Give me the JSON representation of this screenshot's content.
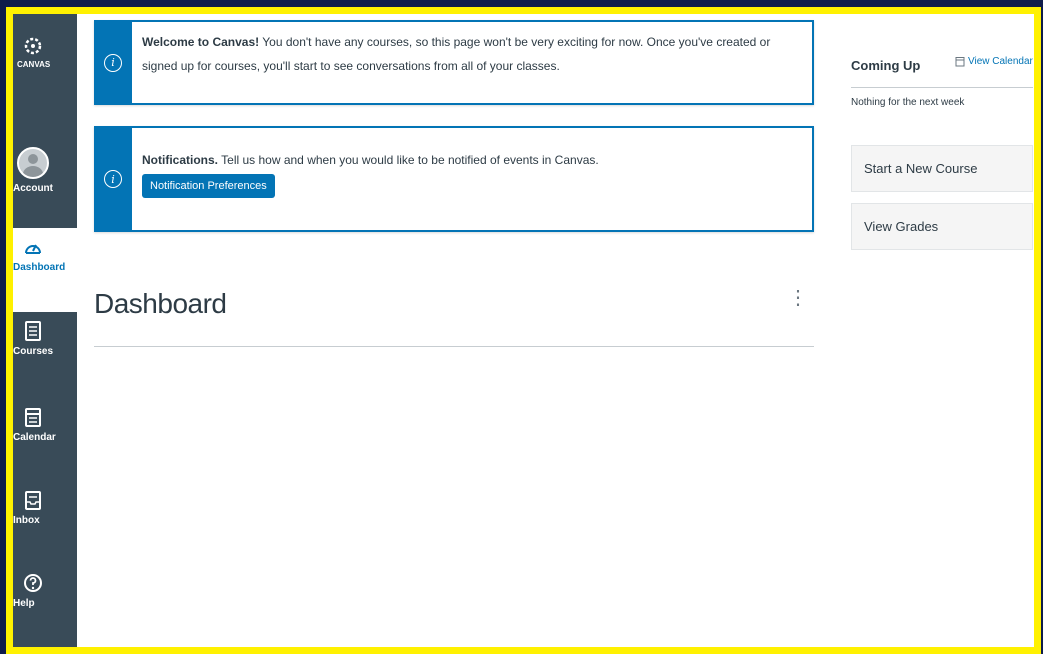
{
  "nav": {
    "logo_label": "CANVAS",
    "items": [
      {
        "label": "Account"
      },
      {
        "label": "Dashboard"
      },
      {
        "label": "Courses"
      },
      {
        "label": "Calendar"
      },
      {
        "label": "Inbox"
      },
      {
        "label": "Help"
      }
    ]
  },
  "alerts": {
    "welcome": {
      "title": "Welcome to Canvas!",
      "body": "You don't have any courses, so this page won't be very exciting for now. Once you've created or signed up for courses, you'll start to see conversations from all of your classes."
    },
    "notifications": {
      "title": "Notifications.",
      "body": "Tell us how and when you would like to be notified of events in Canvas.",
      "button": "Notification Preferences"
    }
  },
  "main": {
    "title": "Dashboard",
    "menu_glyph": "⋮"
  },
  "sidebar": {
    "coming_up": "Coming Up",
    "view_calendar": "View Calendar",
    "nothing": "Nothing for the next week",
    "start_course": "Start a New Course",
    "view_grades": "View Grades"
  },
  "colors": {
    "accent": "#0374b5",
    "nav_bg": "#394b58",
    "frame": "#fff100"
  }
}
